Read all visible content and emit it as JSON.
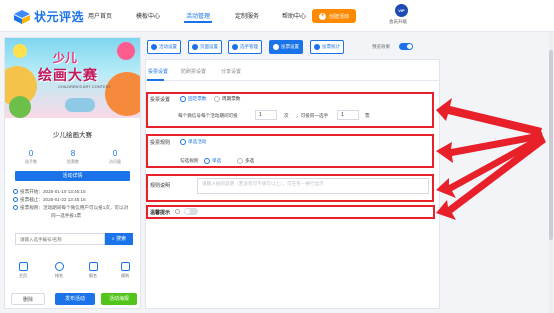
{
  "brand": {
    "name": "状元评选"
  },
  "nav": {
    "items": [
      "用户首页",
      "模板中心",
      "活动管理",
      "定制服务",
      "帮助中心"
    ]
  },
  "header": {
    "create_button": "创建活动",
    "vip_badge": "VIP",
    "vip_label": "会员升级"
  },
  "activity": {
    "banner_line1": "少儿",
    "banner_line2": "绘画大赛",
    "banner_subtitle": "CHILDREN'S ART CONTEST",
    "name": "少儿绘画大赛",
    "stats": [
      {
        "value": "0",
        "label": "选手数"
      },
      {
        "value": "8",
        "label": "投票数"
      },
      {
        "value": "0",
        "label": "访问量"
      }
    ],
    "detail_button": "活动详情",
    "start_time": "投票开始：2025-01-10 13:45:16",
    "end_time": "投票截止：2025-01-22 13:45:16",
    "rule_line1": "投票规则：活动期间每个微信用户可以投1次，可以对",
    "rule_line2": "同一选手投1票",
    "search_placeholder": "请输入选手编号/名称",
    "search_button": "搜索",
    "tabs": [
      "主页",
      "排名",
      "报名",
      "规则"
    ],
    "footer_buttons": [
      "删除",
      "发布活动",
      "活动海报"
    ]
  },
  "toolbar": {
    "buttons": [
      "活动设置",
      "页面设置",
      "选手管理",
      "投票设置",
      "投票统计"
    ],
    "preview_label": "预览效果"
  },
  "subtabs": [
    "投票设置",
    "防刷票设置",
    "分享设置"
  ],
  "settings": {
    "vote_rule_label": "投票设置",
    "vote_rule_options": [
      "固定票数",
      "周期票数"
    ],
    "per_user_prefix": "每个微信号每个活动期间可投",
    "per_user_value": "1",
    "per_user_unit": "次",
    "per_user_mid": "，可投同一选手",
    "per_user_value2": "1",
    "per_user_unit2": "票",
    "vote_type_label": "投票规则",
    "vote_type_selected": "单选活动",
    "select_label": "勾选规则",
    "select_options": [
      "单选",
      "多选"
    ],
    "note_label": "规则说明",
    "note_placeholder": "请输入规则说明（若没有可不填写以上），可在另一换行显示",
    "tip_label": "温馨提示"
  },
  "colors": {
    "accent": "#1a73e8",
    "orange": "#ff8a00",
    "highlight": "#e8202a",
    "green": "#52c41a"
  }
}
